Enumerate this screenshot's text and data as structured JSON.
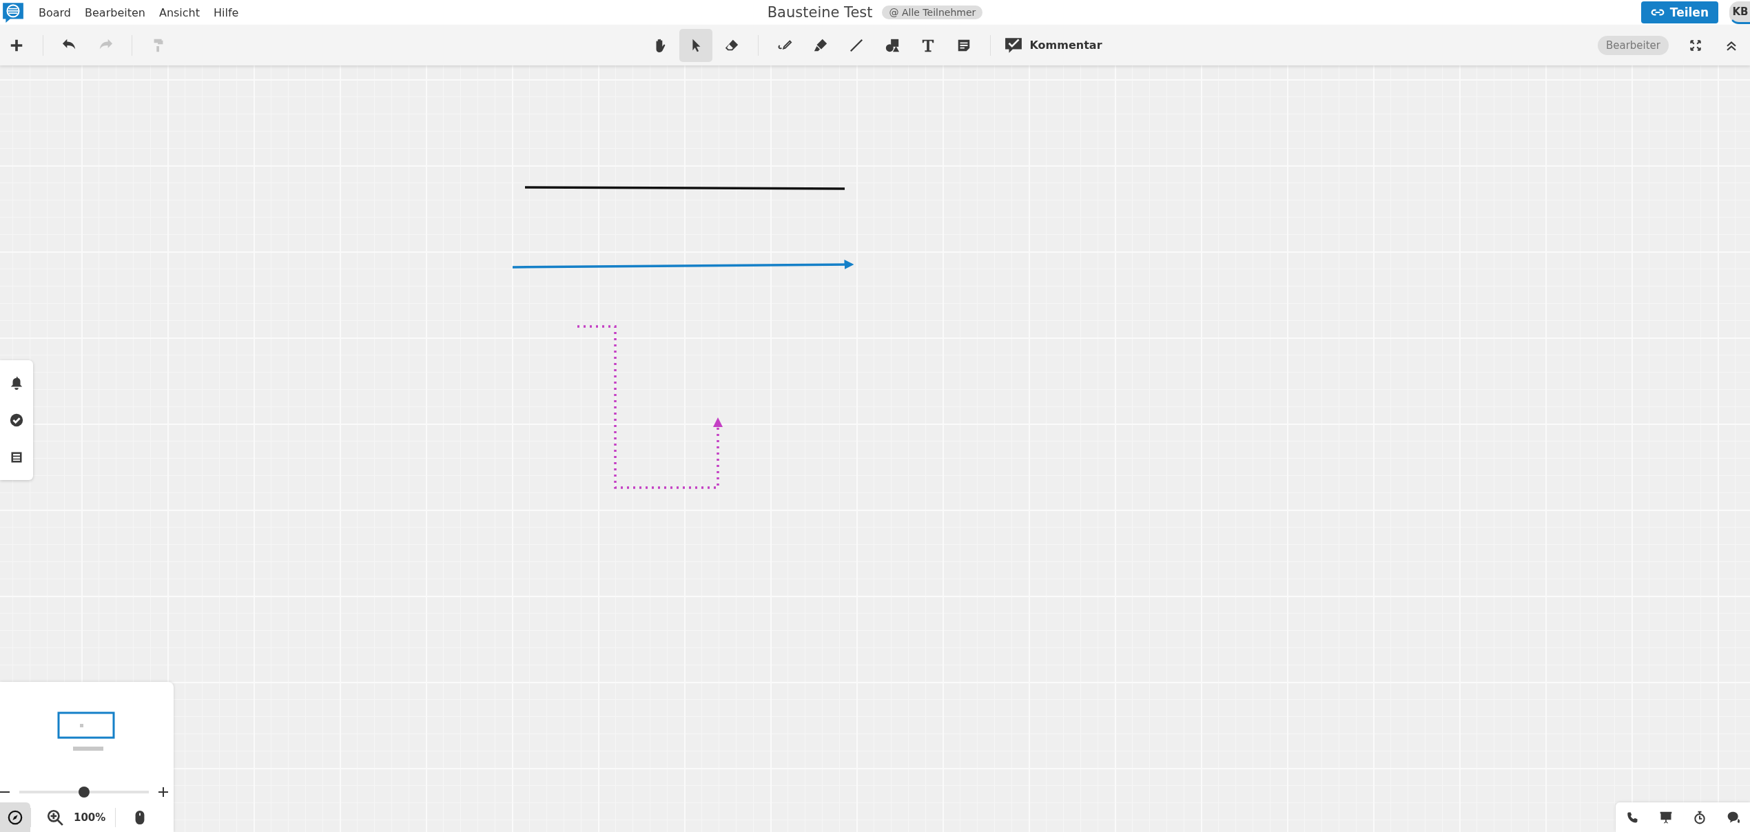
{
  "menu": [
    "Board",
    "Bearbeiten",
    "Ansicht",
    "Hilfe"
  ],
  "title": "Bausteine Test",
  "audience": "@ Alle Teilnehmer",
  "share_button": "Teilen",
  "avatar": "KB",
  "edit_actions": [
    {
      "kind": "add",
      "disabled": false
    },
    {
      "kind": "undo",
      "disabled": false
    },
    {
      "kind": "redo",
      "disabled": true
    },
    {
      "kind": "paint",
      "disabled": true
    }
  ],
  "tools": [
    {
      "kind": "hand",
      "selected": false
    },
    {
      "kind": "select",
      "selected": true
    },
    {
      "kind": "eraser",
      "selected": false
    },
    {
      "kind": "pen",
      "selected": false
    },
    {
      "kind": "highlighter",
      "selected": false
    },
    {
      "kind": "line",
      "selected": false
    },
    {
      "kind": "shapes",
      "selected": false
    },
    {
      "kind": "text",
      "selected": false
    },
    {
      "kind": "note",
      "selected": false
    }
  ],
  "comment_tool": "Kommentar",
  "role": "Bearbeiter",
  "side_panel": [
    {
      "kind": "bell"
    },
    {
      "kind": "check"
    },
    {
      "kind": "list"
    }
  ],
  "zoom": {
    "level": 0.5,
    "reading": "100%"
  },
  "bottom_tools": [
    {
      "kind": "phone"
    },
    {
      "kind": "presentation"
    },
    {
      "kind": "timer"
    },
    {
      "kind": "chat"
    }
  ]
}
